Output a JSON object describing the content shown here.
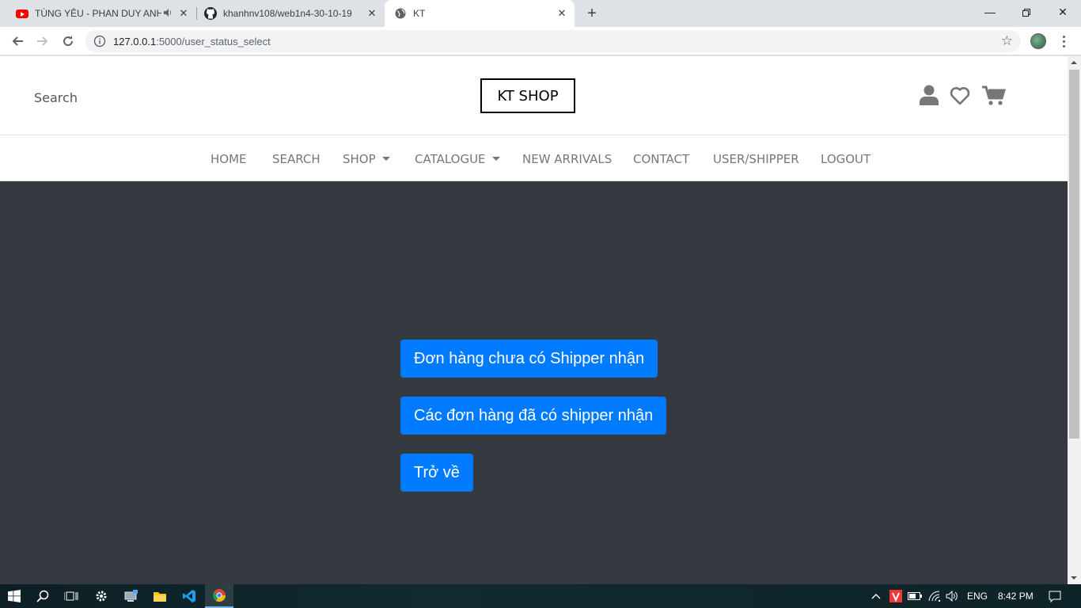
{
  "browser": {
    "tabs": [
      {
        "title": "TÙNG YÊU - PHAN DUY ANH",
        "icon": "youtube-icon",
        "audio": true
      },
      {
        "title": "khanhnv108/web1n4-30-10-19",
        "icon": "github-icon"
      },
      {
        "title": "KT",
        "icon": "globe-icon",
        "active": true
      }
    ],
    "url_host": "127.0.0.1",
    "url_rest": ":5000/user_status_select"
  },
  "header": {
    "search_label": "Search",
    "logo": "KT SHOP"
  },
  "nav": {
    "items": [
      "HOME",
      "SEARCH",
      "SHOP",
      "CATALOGUE",
      "NEW ARRIVALS",
      "CONTACT",
      "USER/SHIPPER",
      "LOGOUT"
    ]
  },
  "main": {
    "buttons": [
      "Đơn hàng chưa có Shipper nhận",
      "Các đơn hàng đã có shipper nhận",
      "Trở về"
    ]
  },
  "taskbar": {
    "language": "ENG",
    "time": "8:42 PM"
  },
  "colors": {
    "primary": "#007bff",
    "dark_bg": "#343a40"
  }
}
